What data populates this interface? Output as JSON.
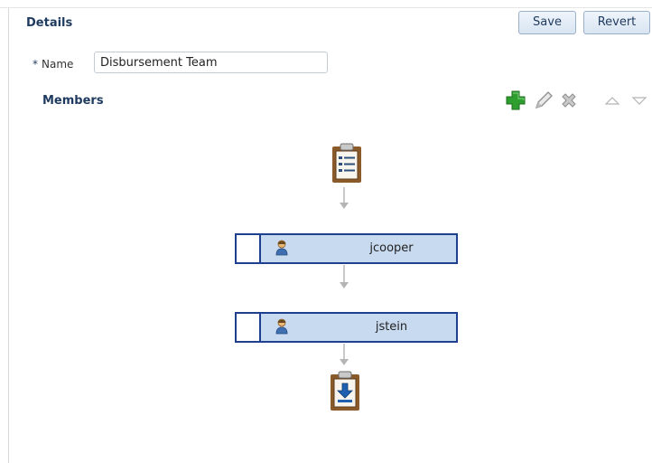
{
  "details": {
    "title": "Details",
    "save_label": "Save",
    "revert_label": "Revert",
    "required_marker": "*",
    "name_label": "Name",
    "name_value": "Disbursement Team"
  },
  "members": {
    "title": "Members",
    "toolbar": [
      "add-icon",
      "edit-icon",
      "delete-icon",
      "move-up-icon",
      "move-down-icon"
    ],
    "list": [
      {
        "name": "jcooper",
        "icon": "user-icon"
      },
      {
        "name": "jstein",
        "icon": "user-icon"
      }
    ],
    "start_icon": "clipboard-list-icon",
    "end_icon": "clipboard-download-icon"
  },
  "colors": {
    "heading": "#1f3a5f",
    "member_fill": "#c8daf0",
    "member_border": "#1f3f8f",
    "add_green": "#2e9e2e",
    "clipboard_brown": "#8b5a2b"
  }
}
